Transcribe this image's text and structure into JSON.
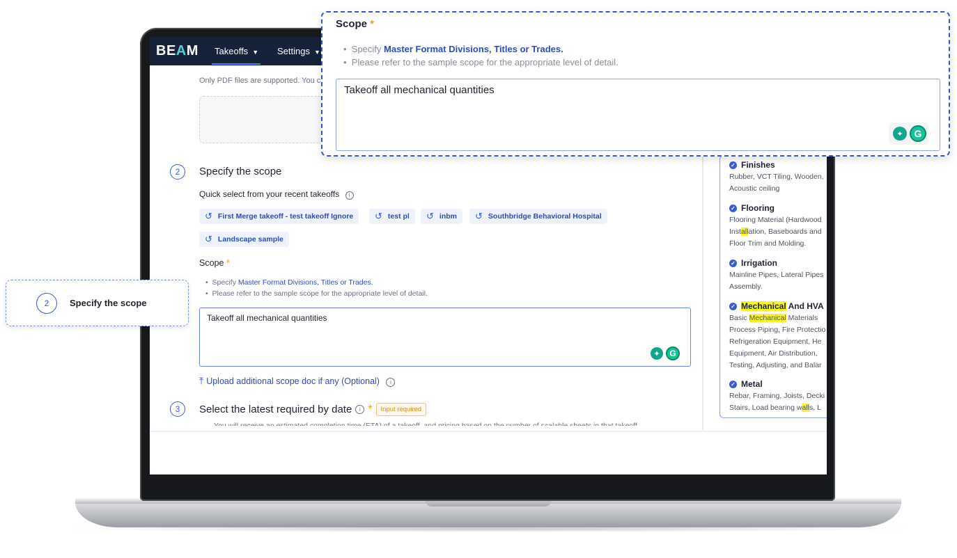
{
  "app": {
    "logo_prefix": "BE",
    "logo_accent": "A",
    "logo_suffix": "M",
    "nav": [
      {
        "label": "Takeoffs"
      },
      {
        "label": "Settings"
      }
    ]
  },
  "upload": {
    "note": "Only PDF files are supported. You ca"
  },
  "step2": {
    "number": "2",
    "title": "Specify the scope",
    "quick_select_label": "Quick select from your recent takeoffs",
    "chips": [
      "First Merge takeoff - test takeoff Ignore",
      "test pl",
      "inbm",
      "Southbridge Behavioral Hospital",
      "Landscape sample"
    ],
    "scope_label": "Scope",
    "required_mark": "*",
    "bullet1_prefix": "Specify ",
    "bullet1_link": "Master Format Divisions, Titles or Trades.",
    "bullet2": "Please refer to the sample scope for the appropriate level of detail.",
    "scope_value": "Takeoff all mechanical quantities",
    "upload_link": "Upload additional scope doc if any (Optional)"
  },
  "step3": {
    "number": "3",
    "title": "Select the latest required by date",
    "required_mark": "*",
    "badge": "Input required",
    "cut_text": "You will receive an estimated completion time (ETA) of a takeoff, and pricing based on the number of scalable sheets in that takeoff."
  },
  "sample_scope": {
    "categories": [
      {
        "title": "Finishes",
        "desc": [
          "Rubber, VCT Tiling, Wooden,",
          "Acoustic ceiling"
        ]
      },
      {
        "title": "Flooring",
        "desc": [
          "Flooring Material (Hardwood",
          "Installation, Baseboards and",
          "Floor Trim and Molding."
        ]
      },
      {
        "title": "Irrigation",
        "desc": [
          "Mainline Pipes, Lateral Pipes",
          "Assembly."
        ]
      },
      {
        "title_hl": "Mechanical",
        "title_rest": " And HVA",
        "desc_hl": "Mechanical",
        "desc": [
          "Process Piping, Fire Protectio",
          "Refrigeration Equipment, He",
          "Equipment, Air Distribution,",
          "Testing, Adjusting, and Balar"
        ],
        "desc_first_prefix": "Basic ",
        "desc_first_suffix": " Materials"
      },
      {
        "title": "Metal",
        "desc": [
          "Rebar, Framing, Joists, Decki",
          "Stairs, Load bearing walls, L"
        ]
      }
    ],
    "flooring_line2_a": "Inst",
    "flooring_line2_hl": "all",
    "flooring_line2_b": "ation, Baseboards and",
    "metal_line2_a": "Stairs, Load bearing w",
    "metal_line2_hl": "all",
    "metal_line2_b": "s, L"
  },
  "callout_zoom": {
    "scope_label": "Scope",
    "required_mark": "*",
    "bullet1_prefix": "Specify ",
    "bullet1_link": "Master Format Divisions, Titles or Trades.",
    "bullet2": "Please refer to the sample scope for the appropriate level of detail.",
    "scope_value": "Takeoff all mechanical quantities"
  },
  "callout_step": {
    "number": "2",
    "title": "Specify the scope"
  },
  "colors": {
    "header_bg": "#16213a",
    "accent": "#3a5bd6",
    "required": "#e89d1a",
    "highlight": "#f9f32b"
  }
}
